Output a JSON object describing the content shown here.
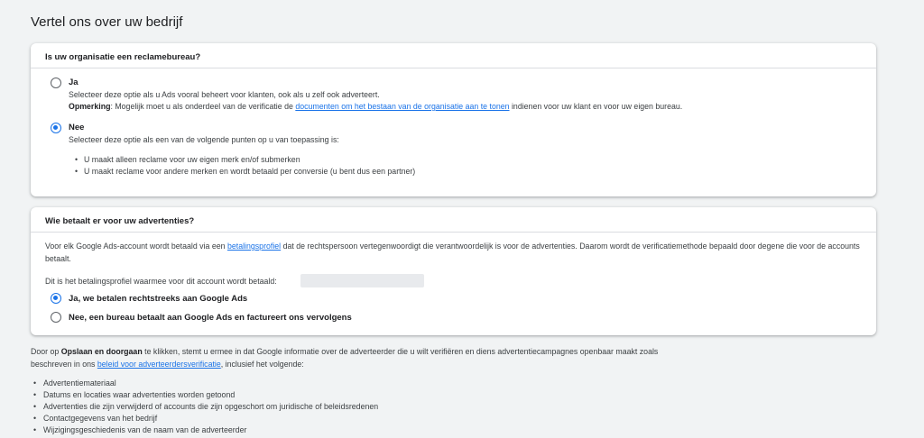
{
  "page": {
    "title": "Vertel ons over uw bedrijf"
  },
  "agency_card": {
    "question": "Is uw organisatie een reclamebureau?",
    "yes": {
      "label": "Ja",
      "description": "Selecteer deze optie als u Ads vooral beheert voor klanten, ook als u zelf ook adverteert.",
      "note_label": "Opmerking",
      "note_prefix": ": Mogelijk moet u als onderdeel van de verificatie de ",
      "note_link": "documenten om het bestaan van de organisatie aan te tonen",
      "note_suffix": " indienen voor uw klant en voor uw eigen bureau.",
      "checked": false
    },
    "no": {
      "label": "Nee",
      "description": "Selecteer deze optie als een van de volgende punten op u van toepassing is:",
      "bullets": [
        "U maakt alleen reclame voor uw eigen merk en/of submerken",
        "U maakt reclame voor andere merken en wordt betaald per conversie (u bent dus een partner)"
      ],
      "checked": true
    }
  },
  "payer_card": {
    "question": "Wie betaalt er voor uw advertenties?",
    "intro_prefix": "Voor elk Google Ads-account wordt betaald via een ",
    "intro_link": "betalingsprofiel",
    "intro_suffix": " dat de rechtspersoon vertegenwoordigt die verantwoordelijk is voor de advertenties. Daarom wordt de verificatiemethode bepaald door degene die voor de accounts betaalt.",
    "profile_label": "Dit is het betalingsprofiel waarmee voor dit account wordt betaald:",
    "options": [
      {
        "label": "Ja, we betalen rechtstreeks aan Google Ads",
        "checked": true
      },
      {
        "label": "Nee, een bureau betaalt aan Google Ads en factureert ons vervolgens",
        "checked": false
      }
    ]
  },
  "footer": {
    "prefix": "Door op ",
    "bold": "Opslaan en doorgaan",
    "middle": " te klikken, stemt u ermee in dat Google informatie over de adverteerder die u wilt verifiëren en diens advertentiecampagnes openbaar maakt zoals beschreven in ons ",
    "link": "beleid voor adverteerdersverificatie",
    "suffix": ", inclusief het volgende:",
    "items": [
      "Advertentiemateriaal",
      "Datums en locaties waar advertenties worden getoond",
      "Advertenties die zijn verwijderd of accounts die zijn opgeschort om juridische of beleidsredenen",
      "Contactgegevens van het bedrijf",
      "Wijzigingsgeschiedenis van de naam van de adverteerder"
    ]
  },
  "colors": {
    "accent": "#1a73e8",
    "background": "#f1f3f4"
  }
}
